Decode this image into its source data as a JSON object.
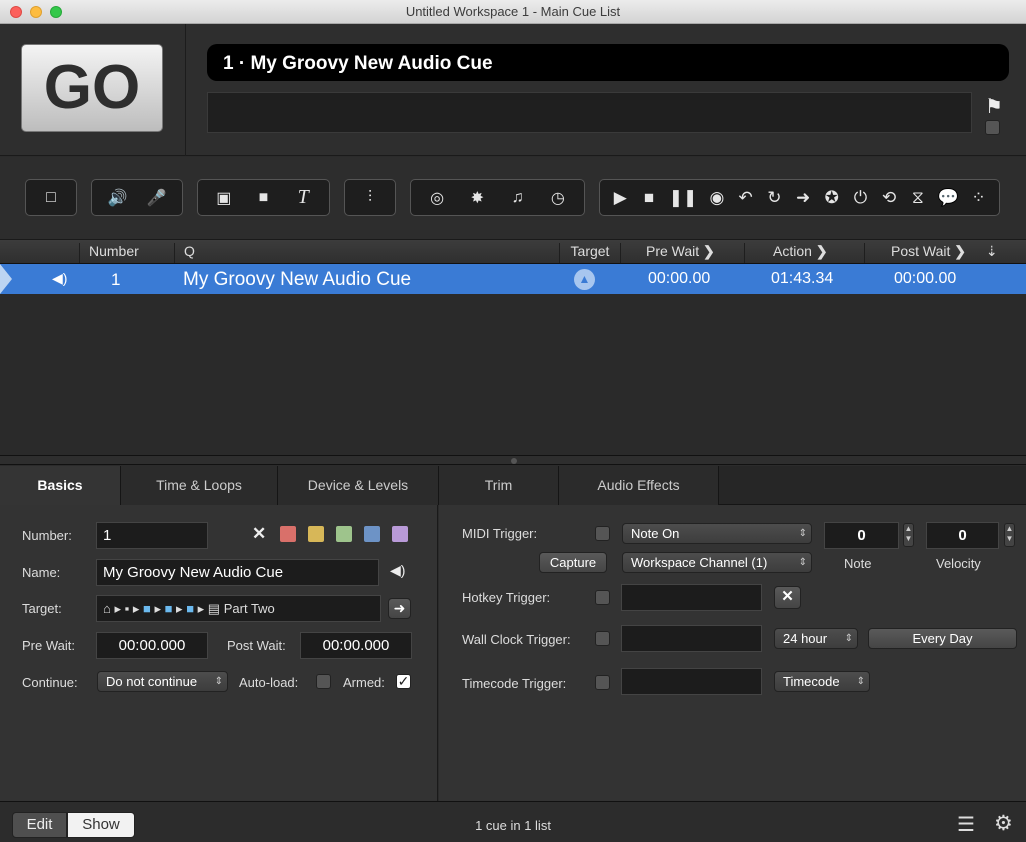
{
  "window": {
    "title": "Untitled Workspace 1 - Main Cue List"
  },
  "go_label": "GO",
  "current_cue_title": "1 · My Groovy New Audio Cue",
  "toolbar_groups": [
    [
      "□"
    ],
    [
      "🔊",
      "🎤"
    ],
    [
      "▣",
      "■",
      "T"
    ],
    [
      "⫶"
    ],
    [
      "◎",
      "✸",
      "♫",
      "◷"
    ],
    [
      "▶",
      "■",
      "❚❚",
      "◉",
      "↶",
      "↻",
      "➜",
      "✪",
      "⏻",
      "⟲",
      "⧖",
      "💬",
      "⁘"
    ]
  ],
  "list_header": {
    "number": "Number",
    "q": "Q",
    "target": "Target",
    "pre_wait": "Pre Wait",
    "action": "Action",
    "post_wait": "Post Wait"
  },
  "cue": {
    "number": "1",
    "name": "My Groovy New Audio Cue",
    "pre_wait": "00:00.00",
    "action": "01:43.34",
    "post_wait": "00:00.00"
  },
  "tabs": [
    "Basics",
    "Time & Loops",
    "Device & Levels",
    "Trim",
    "Audio Effects"
  ],
  "basics": {
    "number_label": "Number:",
    "number_value": "1",
    "name_label": "Name:",
    "name_value": "My Groovy New Audio Cue",
    "target_label": "Target:",
    "target_value": "Part Two",
    "pre_wait_label": "Pre Wait:",
    "pre_wait_value": "00:00.000",
    "post_wait_label": "Post Wait:",
    "post_wait_value": "00:00.000",
    "continue_label": "Continue:",
    "continue_value": "Do not continue",
    "autoload_label": "Auto-load:",
    "armed_label": "Armed:",
    "swatch_colors": [
      "#d9706a",
      "#d7b758",
      "#9ec48c",
      "#6d93c6",
      "#b99ad8"
    ]
  },
  "triggers": {
    "midi_label": "MIDI Trigger:",
    "midi_type": "Note On",
    "capture": "Capture",
    "channel": "Workspace Channel (1)",
    "note_value": "0",
    "velocity_value": "0",
    "note_label": "Note",
    "velocity_label": "Velocity",
    "hotkey_label": "Hotkey Trigger:",
    "wallclock_label": "Wall Clock Trigger:",
    "hour_mode": "24 hour",
    "every_day": "Every Day",
    "timecode_label": "Timecode Trigger:",
    "timecode_btn": "Timecode"
  },
  "bottom": {
    "edit": "Edit",
    "show": "Show",
    "status": "1 cue in 1 list"
  }
}
